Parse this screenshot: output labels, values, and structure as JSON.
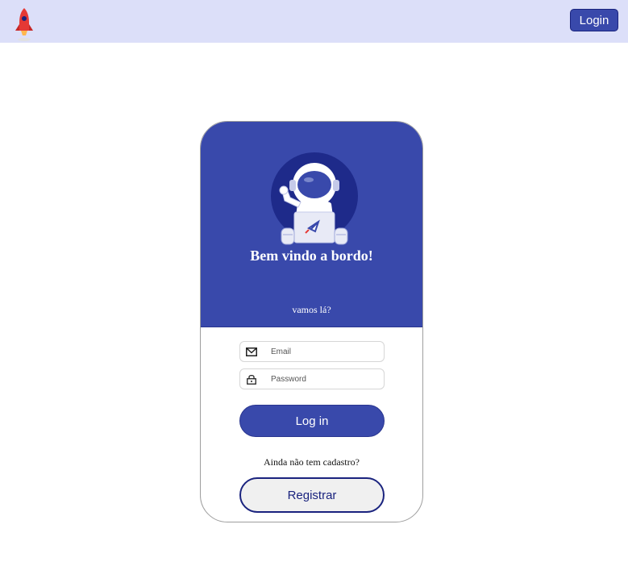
{
  "header": {
    "logo_icon": "rocket-icon",
    "login_label": "Login",
    "background": "#dcdff9",
    "accent": "#3949ab"
  },
  "card": {
    "illustration": "astronaut-with-laptop",
    "welcome_title": "Bem vindo a bordo!",
    "subtitle": "vamos lá?",
    "email": {
      "icon": "envelope-icon",
      "placeholder": "Email",
      "value": ""
    },
    "password": {
      "icon": "lock-icon",
      "placeholder": "Password",
      "value": ""
    },
    "login_button_label": "Log in",
    "no_account_text": "Ainda não tem cadastro?",
    "register_button_label": "Registrar",
    "header_color": "#3949ab"
  }
}
